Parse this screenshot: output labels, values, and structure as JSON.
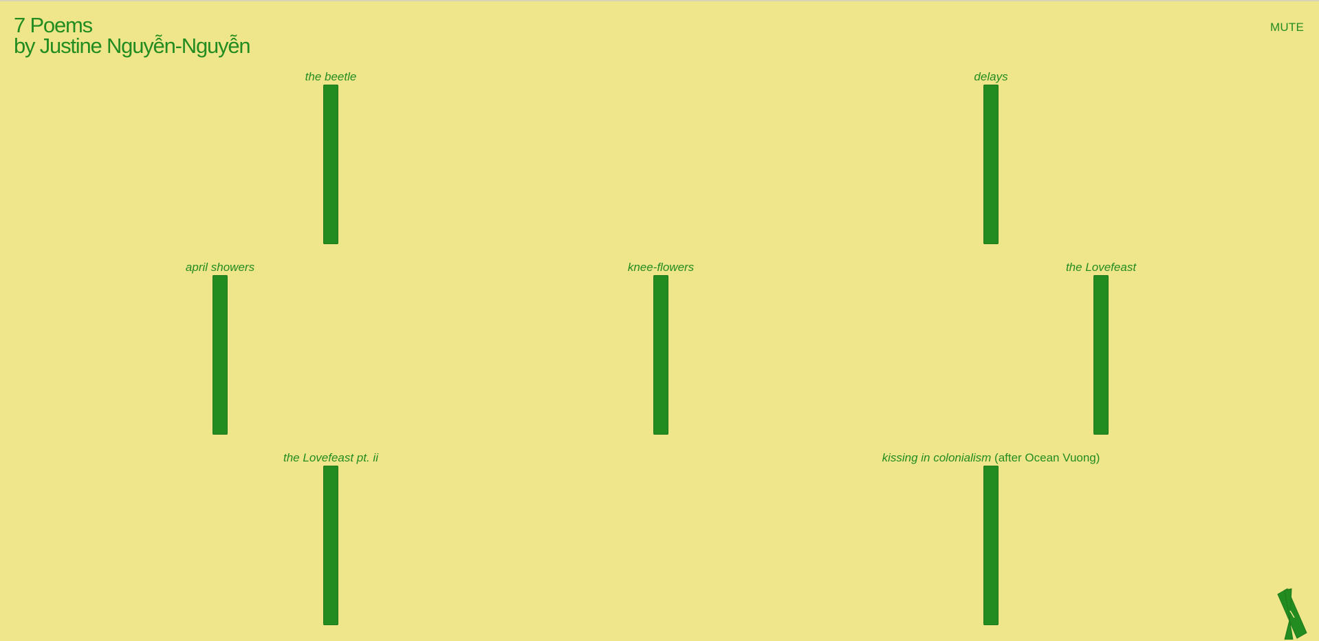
{
  "header": {
    "title": "7 Poems",
    "author": "by Justine Nguyễn-Nguyễn"
  },
  "controls": {
    "mute_label": "MUTE"
  },
  "poems": [
    {
      "title": "the beetle",
      "subtitle": ""
    },
    {
      "title": "delays",
      "subtitle": ""
    },
    {
      "title": "april showers",
      "subtitle": ""
    },
    {
      "title": "knee-flowers",
      "subtitle": ""
    },
    {
      "title": "the Lovefeast",
      "subtitle": ""
    },
    {
      "title": "the Lovefeast pt. ii",
      "subtitle": ""
    },
    {
      "title": "kissing in colonialism",
      "subtitle": " (after Ocean Vuong)"
    }
  ],
  "icons": {
    "corner": "hourglass-icon"
  },
  "colors": {
    "background": "#efe68b",
    "accent": "#238c20"
  }
}
